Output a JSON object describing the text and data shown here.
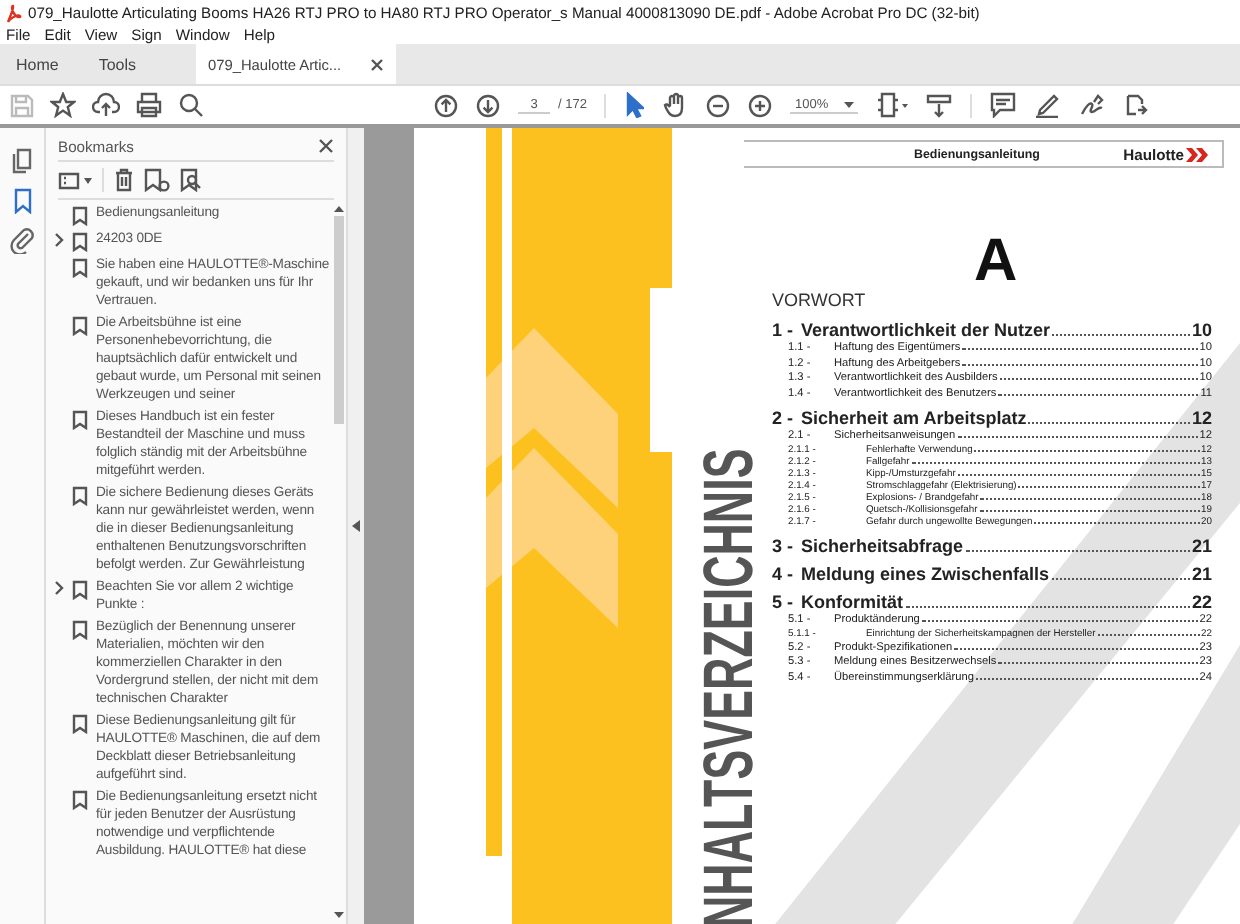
{
  "window": {
    "title": "079_Haulotte Articulating Booms HA26 RTJ PRO to HA80 RTJ PRO Operator_s Manual 4000813090 DE.pdf - Adobe Acrobat Pro DC (32-bit)"
  },
  "menu": [
    "File",
    "Edit",
    "View",
    "Sign",
    "Window",
    "Help"
  ],
  "tabs": [
    {
      "label": "Home",
      "selected": false,
      "kind": "nav"
    },
    {
      "label": "Tools",
      "selected": false,
      "kind": "nav"
    },
    {
      "label": "079_Haulotte Artic...",
      "selected": true,
      "kind": "document"
    }
  ],
  "toolbar": {
    "page_number": "3",
    "page_count": "/ 172",
    "zoom": "100%"
  },
  "side_rail": [
    {
      "kind": "pages",
      "selected": false
    },
    {
      "kind": "bookmarks",
      "selected": true
    },
    {
      "kind": "attachments",
      "selected": false
    }
  ],
  "bookmarks": {
    "title": "Bookmarks",
    "items": [
      {
        "label": "Bedienungsanleitung",
        "expandable": false
      },
      {
        "label": "24203 0DE",
        "expandable": true
      },
      {
        "label": "Sie haben eine HAULOTTE®-Maschine gekauft, und wir bedanken uns für Ihr Vertrauen.",
        "expandable": false
      },
      {
        "label": "Die Arbeitsbühne ist eine Personenhebevorrichtung, die hauptsächlich dafür entwickelt und gebaut wurde, um Personal mit seinen Werkzeugen und seiner",
        "expandable": false
      },
      {
        "label": "Dieses Handbuch ist ein fester Bestandteil der Maschine und muss folglich ständig mit der Arbeitsbühne mitgeführt werden.",
        "expandable": false
      },
      {
        "label": "Die sichere Bedienung dieses Geräts kann nur gewährleistet werden, wenn die in dieser Bedienungsanleitung enthaltenen Benutzungsvorschriften befolgt werden. Zur Gewährleistung",
        "expandable": false
      },
      {
        "label": "Beachten Sie vor allem 2 wichtige Punkte :",
        "expandable": true
      },
      {
        "label": "Bezüglich der Benennung unserer Materialien, möchten wir den kommerziellen Charakter in den Vordergrund stellen, der nicht mit dem technischen Charakter",
        "expandable": false
      },
      {
        "label": "Diese Bedienungsanleitung gilt für HAULOTTE® Maschinen, die auf dem Deckblatt dieser Betriebsanleitung aufgeführt sind.",
        "expandable": false
      },
      {
        "label": "Die Bedienungsanleitung ersetzt nicht für jeden Benutzer der Ausrüstung notwendige und verpflichtende Ausbildung. HAULOTTE® hat diese",
        "expandable": false
      }
    ]
  },
  "document": {
    "header": "Bedienungsanleitung",
    "logo": "Haulotte",
    "section_letter": "A",
    "side_title": "NHALTSVERZEICHNIS",
    "toc": {
      "heading": "VORWORT",
      "chapters": [
        {
          "number": "1 -",
          "title": "Verantwortlichkeit der Nutzer",
          "page": "10",
          "children": [
            {
              "number": "1.1 -",
              "title": "Haftung des Eigentümers",
              "page": "10"
            },
            {
              "number": "1.2 -",
              "title": "Haftung des Arbeitgebers",
              "page": "10"
            },
            {
              "number": "1.3 -",
              "title": "Verantwortlichkeit des Ausbilders",
              "page": "10"
            },
            {
              "number": "1.4 -",
              "title": "Verantwortlichkeit des Benutzers",
              "page": "11"
            }
          ]
        },
        {
          "number": "2 -",
          "title": "Sicherheit am Arbeitsplatz",
          "page": "12",
          "children": [
            {
              "number": "2.1 -",
              "title": "Sicherheitsanweisungen",
              "page": "12",
              "children": [
                {
                  "number": "2.1.1 -",
                  "title": "Fehlerhafte Verwendung",
                  "page": "12"
                },
                {
                  "number": "2.1.2 -",
                  "title": "Fallgefahr",
                  "page": "13"
                },
                {
                  "number": "2.1.3 -",
                  "title": "Kipp-/Umsturzgefahr",
                  "page": "15"
                },
                {
                  "number": "2.1.4 -",
                  "title": "Stromschlaggefahr (Elektrisierung)",
                  "page": "17"
                },
                {
                  "number": "2.1.5 -",
                  "title": "Explosions- / Brandgefahr",
                  "page": "18"
                },
                {
                  "number": "2.1.6 -",
                  "title": "Quetsch-/Kollisionsgefahr",
                  "page": "19"
                },
                {
                  "number": "2.1.7 -",
                  "title": "Gefahr durch ungewollte Bewegungen",
                  "page": "20"
                }
              ]
            }
          ]
        },
        {
          "number": "3 -",
          "title": "Sicherheitsabfrage",
          "page": "21"
        },
        {
          "number": "4 -",
          "title": "Meldung eines Zwischenfalls",
          "page": "21"
        },
        {
          "number": "5 -",
          "title": "Konformität",
          "page": "22",
          "children": [
            {
              "number": "5.1 -",
              "title": "Produktänderung",
              "page": "22",
              "children": [
                {
                  "number": "5.1.1 -",
                  "title": "Einrichtung der Sicherheitskampagnen der Hersteller",
                  "page": "22"
                }
              ]
            },
            {
              "number": "5.2 -",
              "title": "Produkt-Spezifikationen",
              "page": "23"
            },
            {
              "number": "5.3 -",
              "title": "Meldung eines Besitzerwechsels",
              "page": "23"
            },
            {
              "number": "5.4 -",
              "title": "Übereinstimmungserklärung",
              "page": "24"
            }
          ]
        }
      ]
    }
  }
}
